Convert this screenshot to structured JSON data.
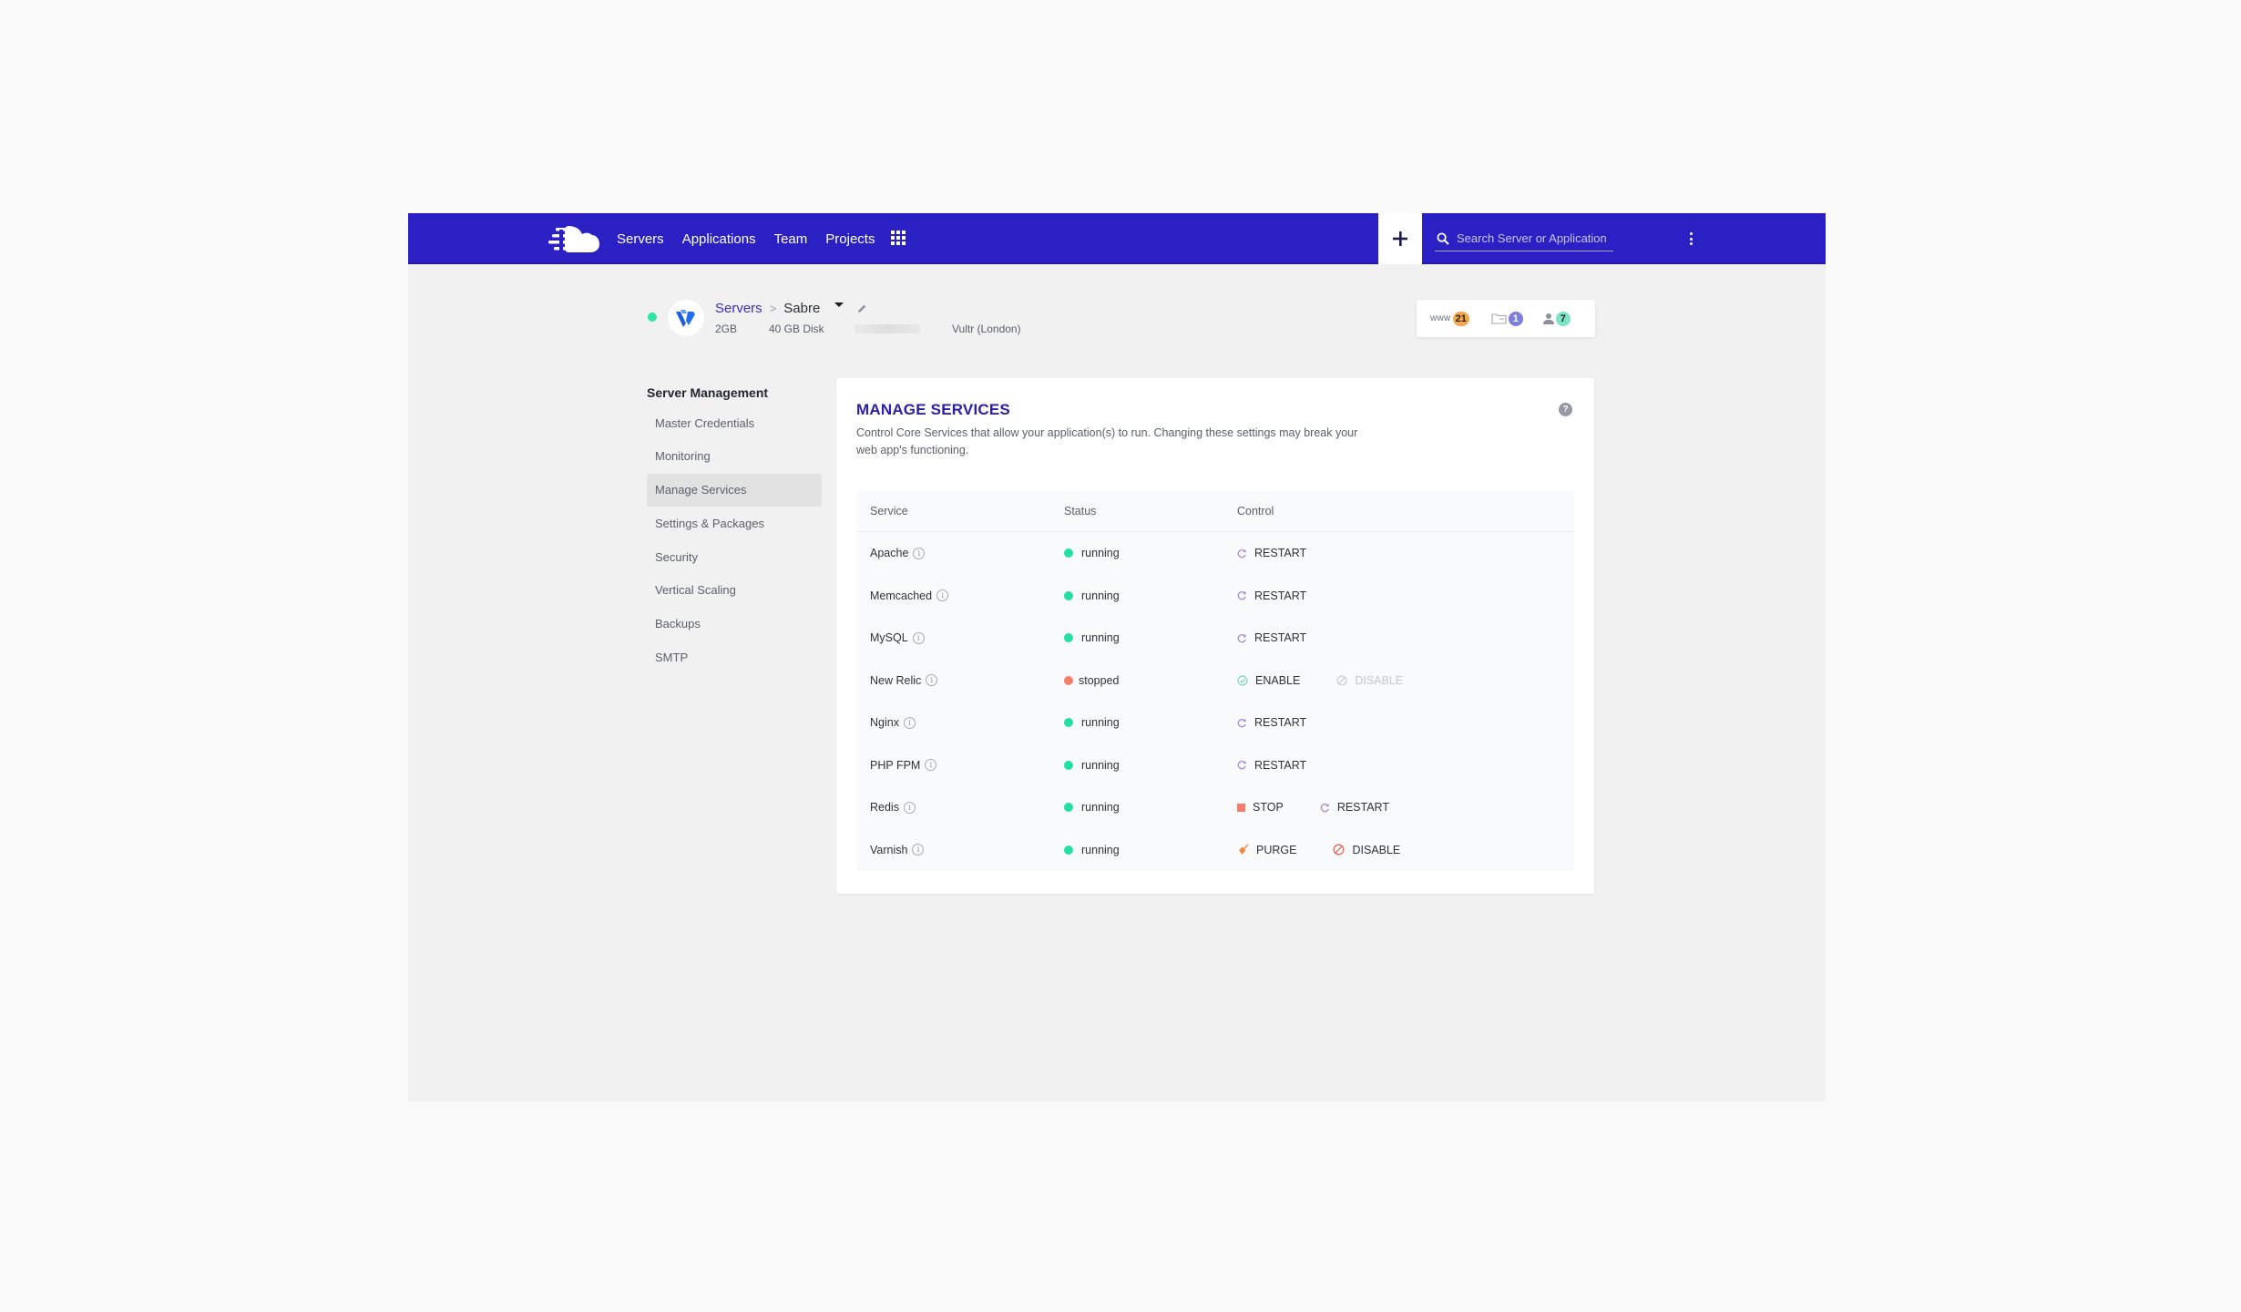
{
  "navbar": {
    "brand_color": "#2b20c4",
    "links": [
      {
        "label": "Servers"
      },
      {
        "label": "Applications"
      },
      {
        "label": "Team"
      },
      {
        "label": "Projects"
      }
    ],
    "apps_icon": "grid-icon",
    "add_icon": "plus-icon",
    "search": {
      "placeholder": "Search Server or Application",
      "value": ""
    },
    "more_icon": "kebab-icon"
  },
  "server": {
    "status": "online",
    "status_color": "#2ee6a3",
    "provider_logo": "vultr-logo",
    "breadcrumb": {
      "parent": "Servers",
      "separator": ">",
      "current": "Sabre"
    },
    "ram": "2GB",
    "disk": "40 GB Disk",
    "ip_redacted": true,
    "provider": "Vultr (London)",
    "stats": {
      "apps": {
        "label": "www",
        "count": "21",
        "color": "#f5a74b"
      },
      "projects": {
        "icon": "folder-icon",
        "count": "1",
        "color": "#7c7fdb"
      },
      "members": {
        "icon": "user-icon",
        "count": "7",
        "color": "#7de3c4"
      }
    }
  },
  "sidebar": {
    "title": "Server Management",
    "items": [
      {
        "label": "Master Credentials",
        "active": false
      },
      {
        "label": "Monitoring",
        "active": false
      },
      {
        "label": "Manage Services",
        "active": true
      },
      {
        "label": "Settings & Packages",
        "active": false
      },
      {
        "label": "Security",
        "active": false
      },
      {
        "label": "Vertical Scaling",
        "active": false
      },
      {
        "label": "Backups",
        "active": false
      },
      {
        "label": "SMTP",
        "active": false
      }
    ]
  },
  "main": {
    "title": "MANAGE SERVICES",
    "description": "Control Core Services that allow your application(s) to run. Changing these settings may break your web app's functioning.",
    "help_icon": "question-icon",
    "table": {
      "headers": {
        "service": "Service",
        "status": "Status",
        "control": "Control"
      },
      "rows": [
        {
          "service": "Apache",
          "status": "running",
          "controls": [
            {
              "label": "RESTART",
              "icon": "restart-icon",
              "enabled": true
            }
          ]
        },
        {
          "service": "Memcached",
          "status": "running",
          "controls": [
            {
              "label": "RESTART",
              "icon": "restart-icon",
              "enabled": true
            }
          ]
        },
        {
          "service": "MySQL",
          "status": "running",
          "controls": [
            {
              "label": "RESTART",
              "icon": "restart-icon",
              "enabled": true
            }
          ]
        },
        {
          "service": "New Relic",
          "status": "stopped",
          "controls": [
            {
              "label": "ENABLE",
              "icon": "check-circle-icon",
              "enabled": true
            },
            {
              "label": "DISABLE",
              "icon": "disable-icon",
              "enabled": false
            }
          ]
        },
        {
          "service": "Nginx",
          "status": "running",
          "controls": [
            {
              "label": "RESTART",
              "icon": "restart-icon",
              "enabled": true
            }
          ]
        },
        {
          "service": "PHP FPM",
          "status": "running",
          "controls": [
            {
              "label": "RESTART",
              "icon": "restart-icon",
              "enabled": true
            }
          ]
        },
        {
          "service": "Redis",
          "status": "running",
          "controls": [
            {
              "label": "STOP",
              "icon": "stop-icon",
              "enabled": true
            },
            {
              "label": "RESTART",
              "icon": "restart-icon",
              "enabled": true
            }
          ]
        },
        {
          "service": "Varnish",
          "status": "running",
          "controls": [
            {
              "label": "PURGE",
              "icon": "broom-icon",
              "enabled": true
            },
            {
              "label": "DISABLE",
              "icon": "disable-icon",
              "enabled": true
            }
          ]
        }
      ]
    },
    "status_colors": {
      "running": "#23e0a0",
      "stopped": "#f47d6e"
    }
  }
}
